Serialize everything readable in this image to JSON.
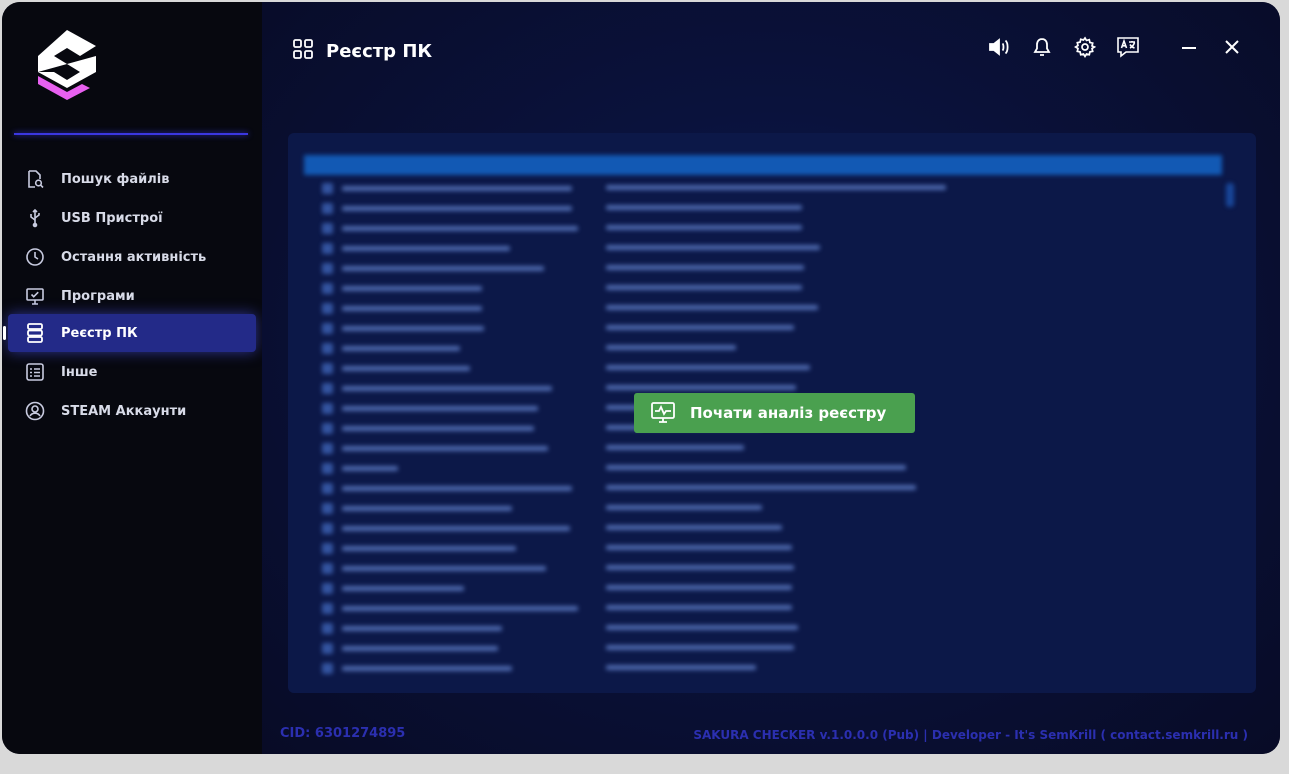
{
  "sidebar": {
    "items": [
      {
        "label": "Пошук файлів",
        "icon": "file-search-icon"
      },
      {
        "label": "USB Пристрої",
        "icon": "usb-icon"
      },
      {
        "label": "Остання активність",
        "icon": "clock-icon"
      },
      {
        "label": "Програми",
        "icon": "monitor-check-icon"
      },
      {
        "label": "Реєстр ПК",
        "icon": "database-icon",
        "active": true
      },
      {
        "label": "Інше",
        "icon": "list-icon"
      },
      {
        "label": "STEAM Аккаунти",
        "icon": "user-circle-icon"
      }
    ]
  },
  "header": {
    "title": "Реєстр ПК",
    "title_icon": "grid-icon"
  },
  "topbar": {
    "icons": [
      "volume-icon",
      "bell-icon",
      "gear-icon",
      "translate-icon",
      "minimize-icon",
      "close-icon"
    ]
  },
  "main": {
    "start_button_label": "Почати аналіз реєстру",
    "start_button_icon": "monitor-pulse-icon"
  },
  "footer": {
    "cid": "CID: 6301274895",
    "info": "SAKURA CHECKER v.1.0.0.0 (Pub) | Developer - It's SemKrill ( contact.semkrill.ru )"
  },
  "colors": {
    "accent": "#3b37e0",
    "active_nav": "#232a88",
    "button_green": "#4aa04f",
    "footer_text": "#2b2fb0",
    "logo_pink": "#e860f0"
  }
}
